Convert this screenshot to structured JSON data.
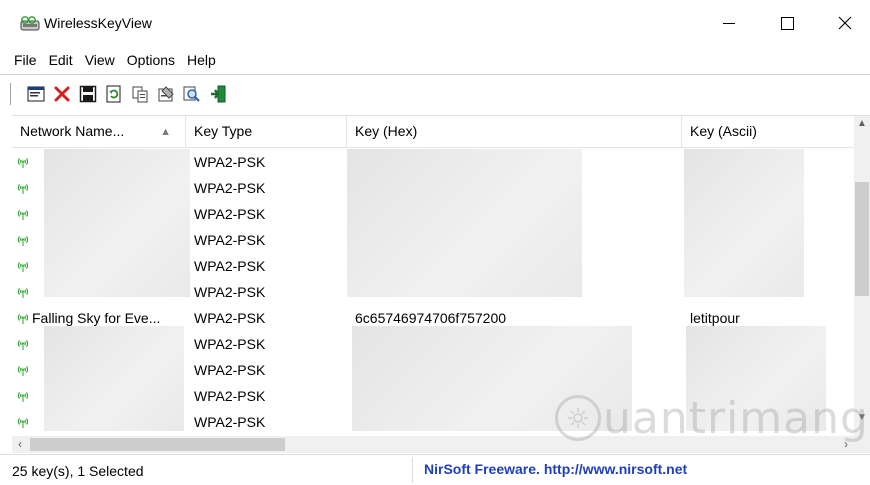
{
  "window": {
    "title": "WirelessKeyView"
  },
  "menu": [
    "File",
    "Edit",
    "View",
    "Options",
    "Help"
  ],
  "toolbar": {
    "buttons": [
      {
        "icon": "properties-window-icon",
        "color": "#1c3f8a"
      },
      {
        "icon": "delete-x-icon",
        "color": "#d81e1e"
      },
      {
        "icon": "save-disk-icon",
        "color": "#1a1a1a"
      },
      {
        "icon": "refresh-icon",
        "color": "#2a8a2a"
      },
      {
        "icon": "copy-icon",
        "color": "#444444"
      },
      {
        "icon": "properties-icon",
        "color": "#444444"
      },
      {
        "icon": "find-icon",
        "color": "#2a5fb0"
      },
      {
        "icon": "exit-icon",
        "color": "#1f8a3a"
      }
    ]
  },
  "columns": [
    "Network Name...",
    "Key Type",
    "Key (Hex)",
    "Key (Ascii)"
  ],
  "sort_indicator": "▲",
  "rows": [
    {
      "network": "",
      "key_type": "WPA2-PSK",
      "key_hex": "",
      "key_ascii": ""
    },
    {
      "network": "",
      "key_type": "WPA2-PSK",
      "key_hex": "",
      "key_ascii": ""
    },
    {
      "network": "",
      "key_type": "WPA2-PSK",
      "key_hex": "",
      "key_ascii": ""
    },
    {
      "network": "",
      "key_type": "WPA2-PSK",
      "key_hex": "",
      "key_ascii": ""
    },
    {
      "network": "",
      "key_type": "WPA2-PSK",
      "key_hex": "",
      "key_ascii": ""
    },
    {
      "network": "",
      "key_type": "WPA2-PSK",
      "key_hex": "",
      "key_ascii": ""
    },
    {
      "network": "Falling Sky for Eve...",
      "key_type": "WPA2-PSK",
      "key_hex": "6c65746974706f757200",
      "key_ascii": "letitpour"
    },
    {
      "network": "",
      "key_type": "WPA2-PSK",
      "key_hex": "",
      "key_ascii": ""
    },
    {
      "network": "",
      "key_type": "WPA2-PSK",
      "key_hex": "",
      "key_ascii": ""
    },
    {
      "network": "",
      "key_type": "WPA2-PSK",
      "key_hex": "",
      "key_ascii": ""
    },
    {
      "network": "",
      "key_type": "WPA2-PSK",
      "key_hex": "",
      "key_ascii": ""
    }
  ],
  "status": {
    "count": "25 key(s), 1 Selected",
    "link": "NirSoft Freeware.  http://www.nirsoft.net",
    "link_color": "#1f3fbf"
  },
  "watermark": {
    "text": "uantrimang"
  },
  "colors": {
    "wifi_icon": "#2aa52a"
  }
}
